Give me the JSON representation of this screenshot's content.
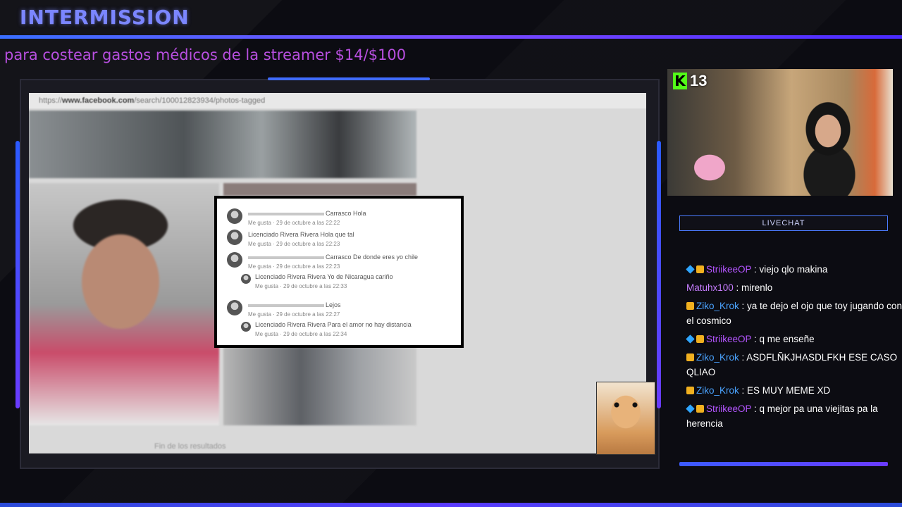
{
  "stream": {
    "title": "INTERMISSION",
    "ticker": "para costear gastos médicos de la streamer $14/$100"
  },
  "browser": {
    "url_prefix": "https://",
    "url_domain": "www.facebook.com",
    "url_path": "/search/100012823934/photos-tagged",
    "end_of_results": "Fin de los resultados"
  },
  "comments": [
    {
      "text": "Carrasco Hola",
      "meta": "Me gusta · 29 de octubre a las 22:22",
      "reply": false,
      "name_hidden": true
    },
    {
      "text": "Licenciado Rivera Rivera Hola que tal",
      "meta": "Me gusta · 29 de octubre a las 22:23",
      "reply": false,
      "name_hidden": false
    },
    {
      "text": "Carrasco De donde eres yo chile",
      "meta": "Me gusta · 29 de octubre a las 22:23",
      "reply": false,
      "name_hidden": true
    },
    {
      "text": "Licenciado Rivera Rivera Yo de Nicaragua cariño",
      "meta": "Me gusta · 29 de octubre a las 22:33",
      "reply": true,
      "name_hidden": false
    },
    {
      "text": "Lejos",
      "meta": "Me gusta · 29 de octubre a las 22:27",
      "reply": false,
      "name_hidden": true
    },
    {
      "text": "Licenciado Rivera Rivera Para el amor no hay distancia",
      "meta": "Me gusta · 29 de octubre a las 22:34",
      "reply": true,
      "name_hidden": false
    }
  ],
  "webcam": {
    "platform_icon": "kick-icon",
    "platform_letter": "K",
    "viewers": "13",
    "accent": "#53fc18"
  },
  "chat": {
    "header": "LIVECHAT",
    "messages": [
      {
        "user": "StriikeeOP",
        "text": ": viejo qlo makina",
        "color": "#b455ff",
        "badges": [
          "gem",
          "crown"
        ]
      },
      {
        "user": "Matuhx100",
        "text": ": mirenlo",
        "color": "#c77dff",
        "badges": []
      },
      {
        "user": "Ziko_Krok",
        "text": ": ya te dejo el ojo que toy jugando con el cosmico",
        "color": "#4aa3ff",
        "badges": [
          "crown"
        ]
      },
      {
        "user": "StriikeeOP",
        "text": ": q me enseñe",
        "color": "#b455ff",
        "badges": [
          "gem",
          "crown"
        ]
      },
      {
        "user": "Ziko_Krok",
        "text": ": ASDFLÑKJHASDLFKH ESE CASO QLIAO",
        "color": "#4aa3ff",
        "badges": [
          "crown"
        ]
      },
      {
        "user": "Ziko_Krok",
        "text": ": ES MUY MEME XD",
        "color": "#4aa3ff",
        "badges": [
          "crown"
        ]
      },
      {
        "user": "StriikeeOP",
        "text": ": q mejor pa una viejitas pa la herencia",
        "color": "#b455ff",
        "badges": [
          "gem",
          "crown"
        ]
      }
    ]
  },
  "colors": {
    "title": "#7b86ff",
    "ticker": "#b84fe0",
    "accent_blue": "#3f6bff",
    "accent_purple": "#6a3bff"
  }
}
